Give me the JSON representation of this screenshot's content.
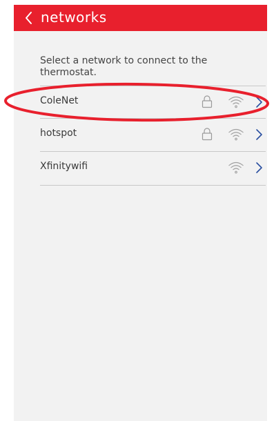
{
  "header": {
    "title": "networks",
    "back_icon": "chevron-left-icon"
  },
  "instruction": "Select a network to connect to the thermostat.",
  "networks": [
    {
      "name": "ColeNet",
      "secured": true,
      "icons": [
        "lock-icon",
        "wifi-icon",
        "chevron-right-icon"
      ]
    },
    {
      "name": "hotspot",
      "secured": true,
      "icons": [
        "lock-icon",
        "wifi-icon",
        "chevron-right-icon"
      ]
    },
    {
      "name": "Xfinitywifi",
      "secured": false,
      "icons": [
        "wifi-icon",
        "chevron-right-icon"
      ]
    }
  ],
  "annotation": {
    "shape": "ellipse",
    "target": "ColeNet"
  },
  "colors": {
    "header": "#e8202d",
    "background": "#f2f2f2",
    "chevron": "#2a4fa0",
    "annotation": "#e8202d"
  }
}
